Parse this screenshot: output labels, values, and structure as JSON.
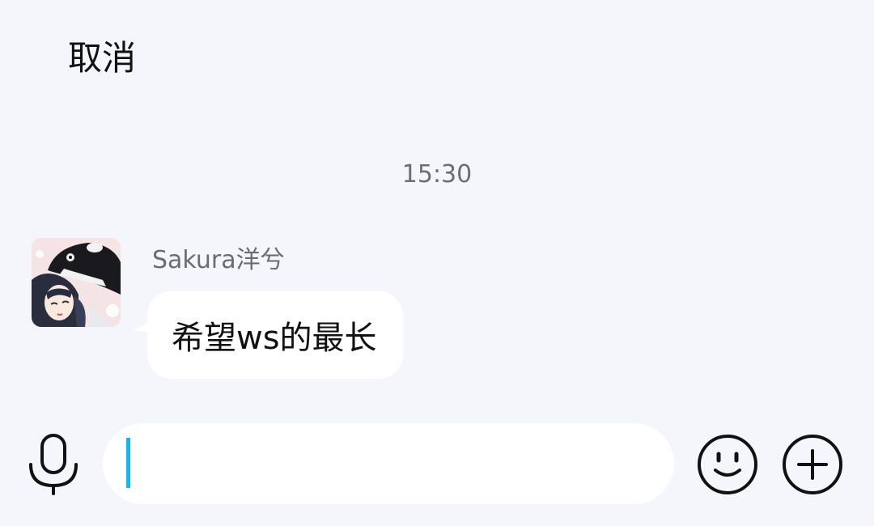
{
  "header": {
    "cancel_label": "取消"
  },
  "chat": {
    "timestamp": "15:30",
    "messages": [
      {
        "sender": "Sakura洋兮",
        "text": "希望ws的最长"
      }
    ]
  },
  "composer": {
    "input_value": "",
    "mic_icon": "microphone-icon",
    "emoji_icon": "smiley-icon",
    "plus_icon": "plus-circle-icon",
    "caret_color": "#17b8e8"
  }
}
